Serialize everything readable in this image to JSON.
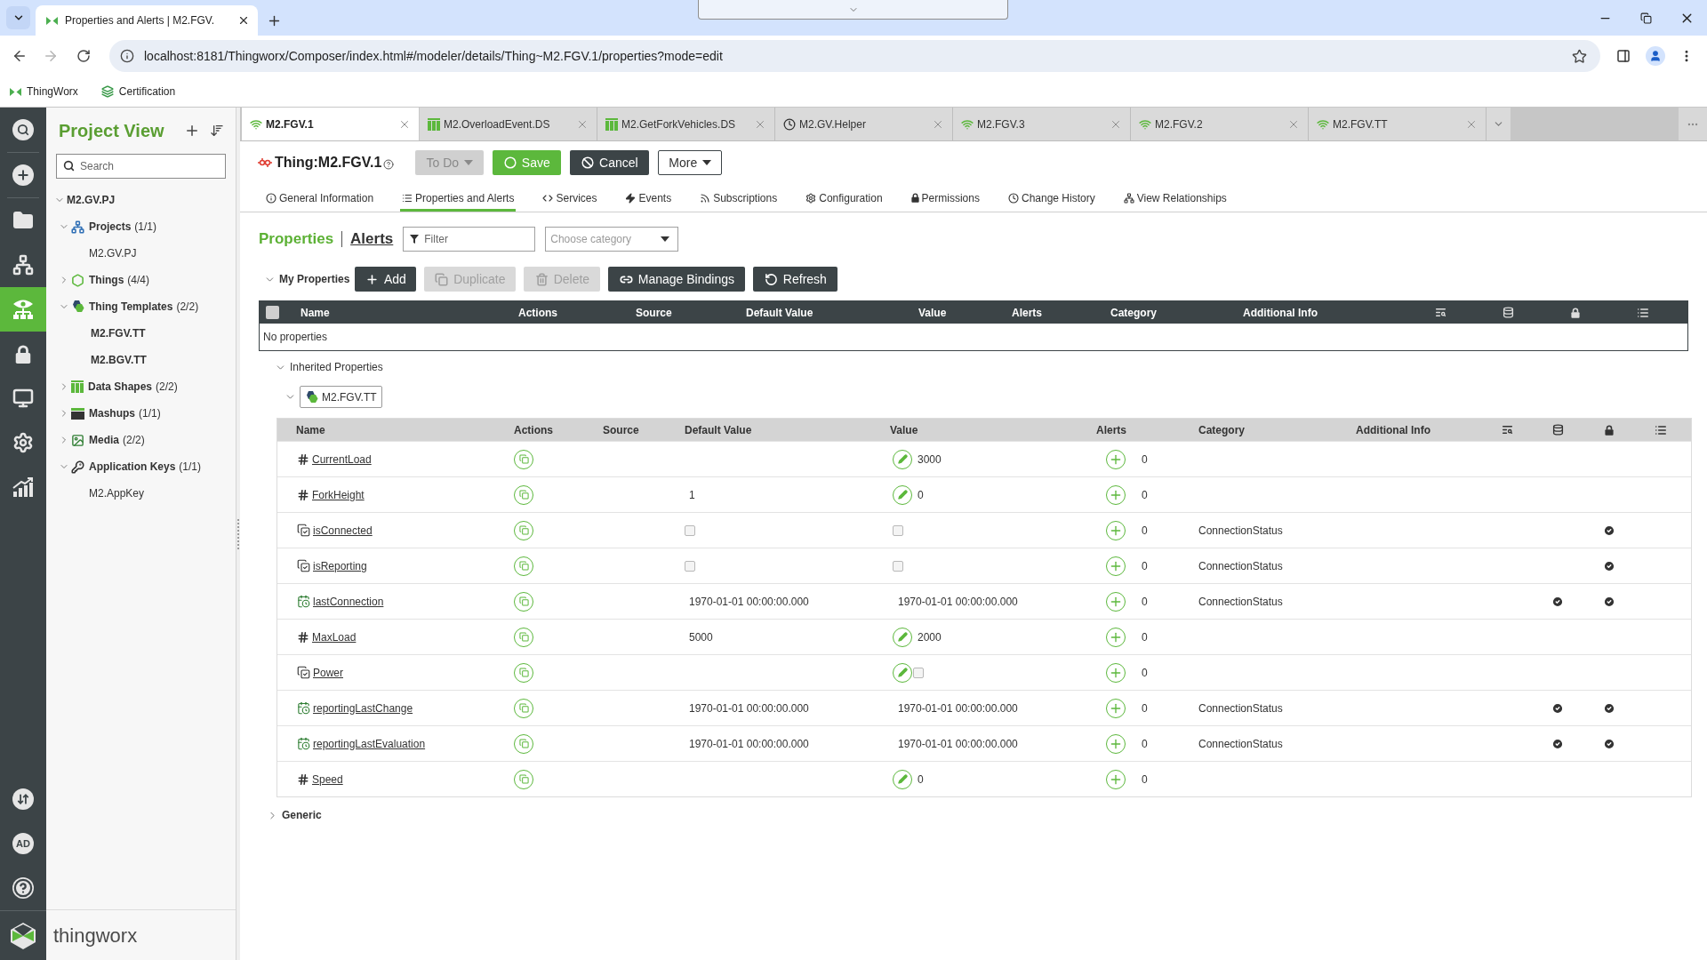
{
  "browser": {
    "tab_title": "Properties and Alerts | M2.FGV.",
    "nav": {
      "back_disabled": false,
      "forward_disabled": true
    },
    "url": "localhost:8181/Thingworx/Composer/index.html#/modeler/details/Thing~M2.FGV.1/properties?mode=edit",
    "bookmarks": [
      {
        "label": "ThingWorx",
        "kind": "thingworx"
      },
      {
        "label": "Certification",
        "kind": "certification"
      }
    ]
  },
  "rail": {
    "items": [
      {
        "kind": "search",
        "selected": false
      },
      {
        "kind": "new",
        "selected": false
      },
      {
        "kind": "browse",
        "selected": false
      },
      {
        "kind": "model",
        "selected": false
      },
      {
        "kind": "project",
        "selected": true
      },
      {
        "kind": "security",
        "selected": false
      },
      {
        "kind": "monitoring",
        "selected": false
      },
      {
        "kind": "settings",
        "selected": false
      },
      {
        "kind": "analytics",
        "selected": false
      }
    ],
    "user_initials": "AD"
  },
  "project_view": {
    "title": "Project View",
    "search_placeholder": "Search",
    "tree": [
      {
        "label": "M2.GV.PJ",
        "expanded": true,
        "children": [
          {
            "label": "Projects",
            "count": "(1/1)",
            "kind": "projects",
            "expanded": true,
            "children": [
              {
                "label": "M2.GV.PJ",
                "bold": false
              }
            ]
          },
          {
            "label": "Things",
            "count": "(4/4)",
            "kind": "things",
            "expanded": false
          },
          {
            "label": "Thing Templates",
            "count": "(2/2)",
            "kind": "templates",
            "expanded": true,
            "children": [
              {
                "label": "M2.FGV.TT",
                "bold": true
              },
              {
                "label": "M2.BGV.TT",
                "bold": true
              }
            ]
          },
          {
            "label": "Data Shapes",
            "count": "(2/2)",
            "kind": "datashapes",
            "expanded": false
          },
          {
            "label": "Mashups",
            "count": "(1/1)",
            "kind": "mashups",
            "expanded": false
          },
          {
            "label": "Media",
            "count": "(2/2)",
            "kind": "media",
            "expanded": false
          },
          {
            "label": "Application Keys",
            "count": "(1/1)",
            "kind": "keys",
            "expanded": true,
            "children": [
              {
                "label": "M2.AppKey",
                "bold": false
              }
            ]
          }
        ]
      }
    ],
    "brand": "thingworx"
  },
  "editor_tabs": [
    {
      "label": "M2.FGV.1",
      "kind": "thing",
      "selected": true
    },
    {
      "label": "M2.OverloadEvent.DS",
      "kind": "datashape",
      "selected": false
    },
    {
      "label": "M2.GetForkVehicles.DS",
      "kind": "datashape",
      "selected": false
    },
    {
      "label": "M2.GV.Helper",
      "kind": "timer",
      "selected": false
    },
    {
      "label": "M2.FGV.3",
      "kind": "thing",
      "selected": false
    },
    {
      "label": "M2.FGV.2",
      "kind": "thing",
      "selected": false
    },
    {
      "label": "M2.FGV.TT",
      "kind": "thing",
      "selected": false
    }
  ],
  "entity": {
    "title": "Thing:M2.FGV.1",
    "actions": [
      {
        "label": "To Do",
        "kind": "status"
      },
      {
        "label": "Save",
        "kind": "save"
      },
      {
        "label": "Cancel",
        "kind": "cancel"
      },
      {
        "label": "More",
        "kind": "more"
      }
    ]
  },
  "detail_tabs": [
    {
      "label": "General Information",
      "kind": "info",
      "selected": false
    },
    {
      "label": "Properties and Alerts",
      "kind": "list",
      "selected": true
    },
    {
      "label": "Services",
      "kind": "code",
      "selected": false
    },
    {
      "label": "Events",
      "kind": "bolt",
      "selected": false
    },
    {
      "label": "Subscriptions",
      "kind": "feed",
      "selected": false
    },
    {
      "label": "Configuration",
      "kind": "gear",
      "selected": false
    },
    {
      "label": "Permissions",
      "kind": "lock",
      "selected": false
    },
    {
      "label": "Change History",
      "kind": "history",
      "selected": false
    },
    {
      "label": "View Relationships",
      "kind": "relations",
      "selected": false
    }
  ],
  "properties_panel": {
    "views": [
      {
        "label": "Properties",
        "selected": true
      },
      {
        "label": "Alerts",
        "selected": false
      }
    ],
    "filter_placeholder": "Filter",
    "category_placeholder": "Choose category",
    "my_properties": {
      "title": "My Properties",
      "expanded": true,
      "buttons": [
        {
          "label": "Add",
          "kind": "add",
          "disabled": false
        },
        {
          "label": "Duplicate",
          "kind": "duplicate",
          "disabled": true
        },
        {
          "label": "Delete",
          "kind": "delete",
          "disabled": true
        },
        {
          "label": "Manage Bindings",
          "kind": "bindings",
          "disabled": false
        },
        {
          "label": "Refresh",
          "kind": "refresh",
          "disabled": false
        }
      ],
      "all_selected": false,
      "columns": [
        "Name",
        "Actions",
        "Source",
        "Default Value",
        "Value",
        "Alerts",
        "Category",
        "Additional Info"
      ],
      "empty_text": "No properties"
    },
    "inherited": {
      "title": "Inherited Properties",
      "expanded": true,
      "groups": [
        {
          "label": "M2.FGV.TT",
          "expanded": true,
          "columns": [
            "Name",
            "Actions",
            "Source",
            "Default Value",
            "Value",
            "Alerts",
            "Category",
            "Additional Info"
          ],
          "rows": [
            {
              "name": "CurrentLoad",
              "kind": "number",
              "value": "3000",
              "value_editable": true,
              "alerts": "0",
              "persistent": false,
              "read_only": false
            },
            {
              "name": "ForkHeight",
              "kind": "number",
              "default_value": "1",
              "value": "0",
              "value_editable": true,
              "alerts": "0",
              "persistent": false,
              "read_only": false
            },
            {
              "name": "isConnected",
              "kind": "boolean",
              "default_checked": false,
              "value_checked": false,
              "value_editable": false,
              "alerts": "0",
              "category": "ConnectionStatus",
              "persistent": false,
              "read_only": true
            },
            {
              "name": "isReporting",
              "kind": "boolean",
              "default_checked": false,
              "value_checked": false,
              "value_editable": false,
              "alerts": "0",
              "category": "ConnectionStatus",
              "persistent": false,
              "read_only": true
            },
            {
              "name": "lastConnection",
              "kind": "datetime",
              "default_value": "1970-01-01 00:00:00.000",
              "value": "1970-01-01 00:00:00.000",
              "value_editable": false,
              "alerts": "0",
              "category": "ConnectionStatus",
              "persistent": true,
              "read_only": true
            },
            {
              "name": "MaxLoad",
              "kind": "number",
              "default_value": "5000",
              "value": "2000",
              "value_editable": true,
              "alerts": "0",
              "persistent": false,
              "read_only": false
            },
            {
              "name": "Power",
              "kind": "boolean",
              "value_checked": false,
              "value_editable": true,
              "alerts": "0",
              "persistent": false,
              "read_only": false
            },
            {
              "name": "reportingLastChange",
              "kind": "datetime",
              "default_value": "1970-01-01 00:00:00.000",
              "value": "1970-01-01 00:00:00.000",
              "value_editable": false,
              "alerts": "0",
              "category": "ConnectionStatus",
              "persistent": true,
              "read_only": true
            },
            {
              "name": "reportingLastEvaluation",
              "kind": "datetime",
              "default_value": "1970-01-01 00:00:00.000",
              "value": "1970-01-01 00:00:00.000",
              "value_editable": false,
              "alerts": "0",
              "category": "ConnectionStatus",
              "persistent": true,
              "read_only": true
            },
            {
              "name": "Speed",
              "kind": "number",
              "value": "0",
              "value_editable": true,
              "alerts": "0",
              "persistent": false,
              "read_only": false
            }
          ]
        }
      ]
    },
    "generic": {
      "title": "Generic",
      "expanded": false
    }
  }
}
